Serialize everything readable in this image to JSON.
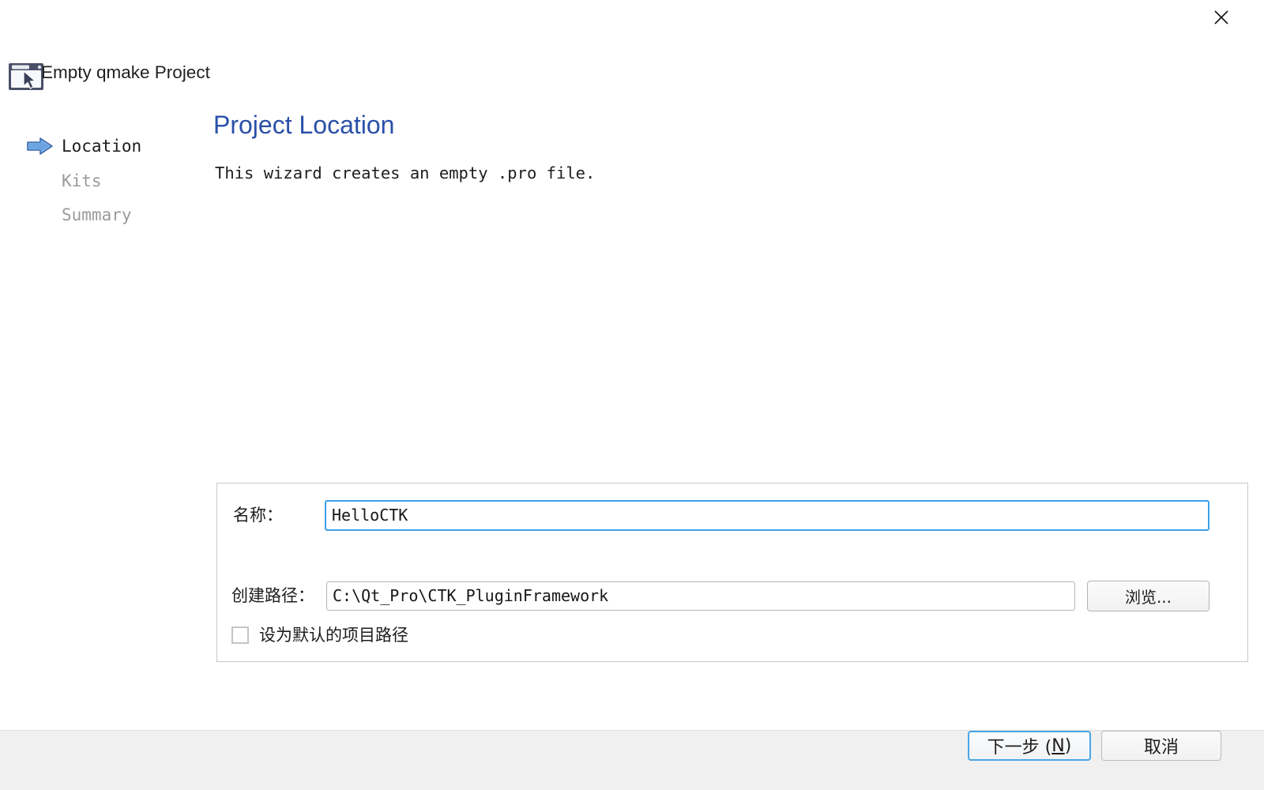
{
  "window": {
    "title": "Empty qmake Project",
    "icon": "window-cursor-icon",
    "close_label": "✕"
  },
  "sidebar": {
    "items": [
      {
        "label": "Location",
        "state": "active",
        "icon": "blue-arrow-icon"
      },
      {
        "label": "Kits",
        "state": "inactive",
        "icon": ""
      },
      {
        "label": "Summary",
        "state": "inactive",
        "icon": ""
      }
    ]
  },
  "main": {
    "title": "Project Location",
    "description": "This wizard creates an empty .pro file."
  },
  "form": {
    "name": {
      "label": "名称：",
      "value": "HelloCTK",
      "placeholder": ""
    },
    "path": {
      "label": "创建路径：",
      "value": "C:\\Qt_Pro\\CTK_PluginFramework",
      "placeholder": ""
    },
    "browse_label": "浏览...",
    "default_path_checkbox": {
      "label": "设为默认的项目路径",
      "checked": false
    }
  },
  "footer": {
    "next_label": "下一步 (",
    "next_accel": "N",
    "next_label_end": ")",
    "cancel_label": "取消"
  },
  "colors": {
    "title_blue": "#2a50a8",
    "focus_blue": "#3ca2e8",
    "default_button_blue": "#48a5e8",
    "footer_bg": "#f0f0f0",
    "inactive_nav": "#9a9a9a"
  }
}
